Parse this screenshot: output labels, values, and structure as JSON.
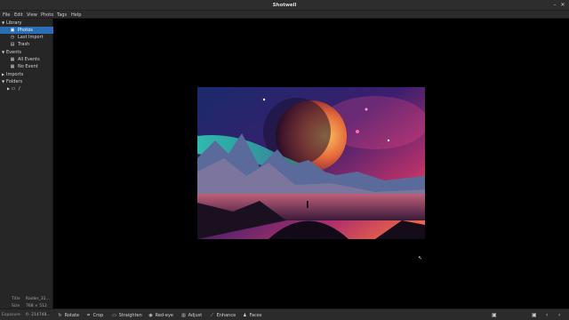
{
  "window": {
    "title": "Shotwell",
    "minimize_icon": "minimize-icon",
    "close_icon": "close-icon"
  },
  "menu": {
    "file": "File",
    "edit": "Edit",
    "view": "View",
    "photo": "Photo",
    "tags": "Tags",
    "help": "Help"
  },
  "sidebar": {
    "library": "Library",
    "photos": "Photos",
    "last_import": "Last Import",
    "trash": "Trash",
    "events": "Events",
    "all_events": "All Events",
    "no_event": "No Event",
    "imports": "Imports",
    "folders": "Folders",
    "folder_root": "/"
  },
  "info": {
    "title_key": "Title",
    "title_val": "Raider_31...",
    "size_key": "Size",
    "size_val": "768 × 512",
    "exposure_key": "Exposure",
    "exposure_val": "f/- 214748..."
  },
  "toolbar": {
    "rotate": "Rotate",
    "crop": "Crop",
    "straighten": "Straighten",
    "redeye": "Red-eye",
    "adjust": "Adjust",
    "enhance": "Enhance",
    "faces": "Faces"
  },
  "colors": {
    "selection": "#2a6fb5",
    "chrome": "#2b2b2b",
    "sidebar": "#262626",
    "viewer": "#000000"
  }
}
